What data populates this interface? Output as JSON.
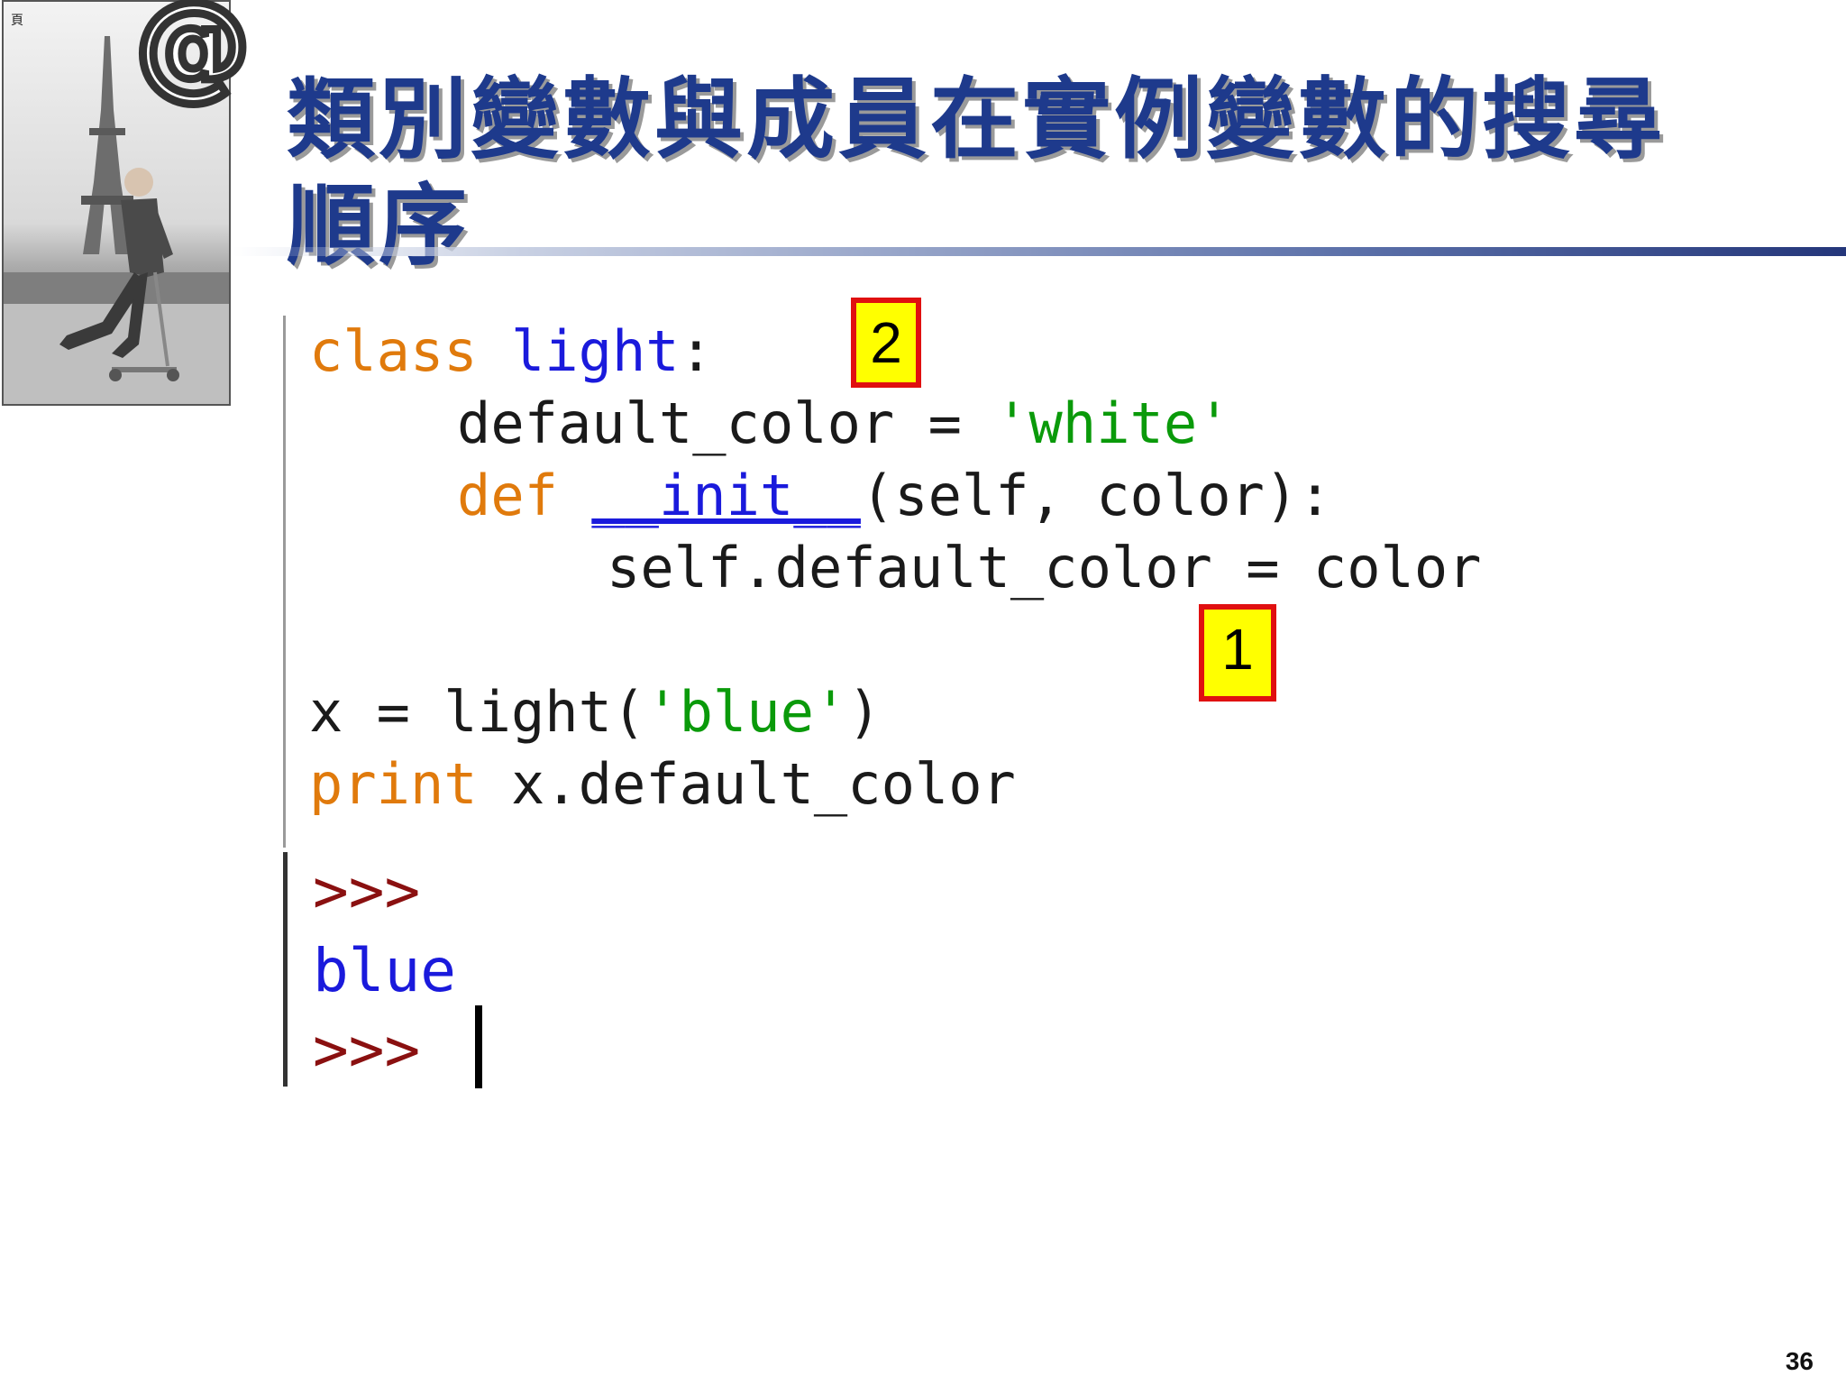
{
  "slide": {
    "title": "類別變數與成員在實例變數的搜尋順序",
    "logo_text": "@",
    "photo_mark": "頁",
    "page_number": "36"
  },
  "colors": {
    "title": "#1e3a8c",
    "keyword": "#e07a0c",
    "name": "#1a1adc",
    "string": "#0a9a0a",
    "prompt": "#8a1010",
    "callout_fill": "#ffff00",
    "callout_border": "#e01010"
  },
  "code": {
    "line1": {
      "kw": "class",
      "name": "light",
      "rest": ":"
    },
    "line2": {
      "lhs": "default_color = ",
      "str": "'white'"
    },
    "line3": {
      "kw": "def",
      "name": "__init__",
      "rest": "(self, color):"
    },
    "line4": {
      "text": "self.default_color = color"
    },
    "line5": {
      "lhs": "x = light(",
      "str": "'blue'",
      "rhs": ")"
    },
    "line6": {
      "kw": "print",
      "rest": " x.default_color"
    }
  },
  "callouts": {
    "first": "1",
    "second": "2"
  },
  "output": {
    "prompt1": ">>>",
    "result": "blue",
    "prompt2": ">>>"
  },
  "icons": {
    "photo": "man-on-scooter-eiffel-tower-photo",
    "cursor": "text-cursor-icon"
  }
}
